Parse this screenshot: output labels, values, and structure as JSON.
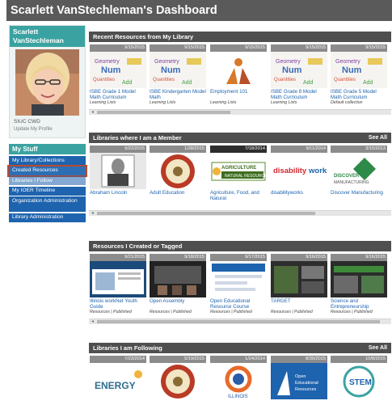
{
  "header": {
    "title": "Scarlett VanStechleman's Dashboard"
  },
  "profile": {
    "name": "Scarlett VanStechleman",
    "org": "SIUC CWD",
    "update_link": "Update My Profile"
  },
  "my_stuff": {
    "heading": "My Stuff",
    "items": [
      {
        "label": "My Library/Collections",
        "state": "normal"
      },
      {
        "label": "Created Resources",
        "state": "highlighted"
      },
      {
        "label": "Libraries I Follow",
        "state": "dim"
      },
      {
        "label": "My IOER Timeline",
        "state": "normal"
      },
      {
        "label": "Organization Administration",
        "state": "normal"
      },
      {
        "label": "Library Administration",
        "state": "normal"
      }
    ]
  },
  "sections": [
    {
      "heading": "Recent Resources from My Library",
      "see_all": "",
      "tiles": [
        {
          "date": "9/15/2015",
          "title": "ISBE Grade 1 Model Math Curriculum",
          "sub": "Learning Lists",
          "icon": "word-cloud"
        },
        {
          "date": "9/15/2015",
          "title": "ISBE Kindergarten Model Math",
          "sub": "Learning Lists",
          "icon": "word-cloud"
        },
        {
          "date": "9/15/2015",
          "title": "Employment 101",
          "sub": "Learning Lists",
          "icon": "orange-logo"
        },
        {
          "date": "9/15/2015",
          "title": "ISBE Grade 8 Model Math Curriculum",
          "sub": "Learning Lists",
          "icon": "word-cloud"
        },
        {
          "date": "9/15/2015",
          "title": "ISBE Grade 5 Model Math Curriculum",
          "sub": "Default collection",
          "icon": "word-cloud"
        }
      ]
    },
    {
      "heading": "Libraries where I am a Member",
      "see_all": "See All",
      "tiles": [
        {
          "date": "9/22/2015",
          "title": "Abraham Lincoln",
          "sub": "",
          "icon": "portrait"
        },
        {
          "date": "1/28/2015",
          "title": "Adult Education",
          "sub": "",
          "icon": "state-seal"
        },
        {
          "date": "7/18/2014",
          "title": "Agriculture, Food, and Natural",
          "sub": "",
          "icon": "agriculture"
        },
        {
          "date": "9/11/2014",
          "title": "disabilityworks",
          "sub": "",
          "icon": "disabilityworks"
        },
        {
          "date": "3/15/2013",
          "title": "Discover Manufacturing",
          "sub": "",
          "icon": "manufacturing"
        }
      ]
    },
    {
      "heading": "Resources I Created or Tagged",
      "see_all": "",
      "tiles": [
        {
          "date": "9/21/2015",
          "title": "Illinois workNet Youth Guide",
          "sub": "Resources | Published",
          "icon": "screenshot"
        },
        {
          "date": "9/18/2015",
          "title": "Open Assembly",
          "sub": "Resources | Published",
          "icon": "classroom"
        },
        {
          "date": "9/17/2015",
          "title": "Open Educational Resource Course",
          "sub": "Resources | Published",
          "icon": "screenshot-blue"
        },
        {
          "date": "9/16/2015",
          "title": "TARGET",
          "sub": "Resources | Published",
          "icon": "screenshot-dark"
        },
        {
          "date": "9/16/2015",
          "title": "Science and Entrepreneurship",
          "sub": "Resources | Published",
          "icon": "screenshot-green"
        }
      ]
    },
    {
      "heading": "Libraries I am Following",
      "see_all": "See All",
      "tiles": [
        {
          "date": "7/23/2014",
          "title": "",
          "sub": "",
          "icon": "energy"
        },
        {
          "date": "5/19/2015",
          "title": "",
          "sub": "",
          "icon": "state-seal"
        },
        {
          "date": "1/24/2014",
          "title": "",
          "sub": "",
          "icon": "illinois-logo"
        },
        {
          "date": "8/30/2015",
          "title": "",
          "sub": "",
          "icon": "oer"
        },
        {
          "date": "10/8/2015",
          "title": "",
          "sub": "",
          "icon": "stem"
        }
      ]
    }
  ],
  "colors": {
    "header_bg": "#5a5a5a",
    "teal": "#3aa3a1",
    "menu_blue": "#1e63ae",
    "highlight_outline": "#b84a32",
    "section_head": "#4f4f4f"
  }
}
